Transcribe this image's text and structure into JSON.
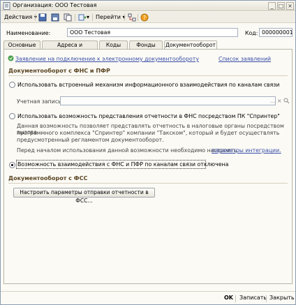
{
  "window": {
    "title": "Организация: ООО Тестовая"
  },
  "toolbar": {
    "actions_label": "Действия",
    "goto_label": "Перейти"
  },
  "form": {
    "name_label": "Наименование:",
    "name_value": "ООО Тестовая",
    "code_label": "Код:",
    "code_value": "000000001"
  },
  "tabs": [
    {
      "label": "Основные"
    },
    {
      "label": "Адреса и телефоны"
    },
    {
      "label": "Коды"
    },
    {
      "label": "Фонды"
    },
    {
      "label": "Документооборот"
    }
  ],
  "doc": {
    "statement_link": "Заявление на подключение к электронному документообороту",
    "statements_list_link": "Список заявлений",
    "fns_header": "Документооборот с ФНС и ПФР",
    "option1": "Использовать встроенный механизм информационного взаимодействия по каналам связи",
    "account_label": "Учетная запись:",
    "option2": "Использовать возможность представления отчетности в ФНС посредством ПК \"Спринтер\"",
    "option2_desc1": "Данная возможность позволяет представлять отчетность в налоговые органы посредством вызова",
    "option2_desc2": "программного комплекса \"Спринтер\" компании \"Такском\", который и будет осуществлять",
    "option2_desc3": "предусмотренный регламентом документооборот.",
    "integration_text": "Перед началом использования данной возможности необходимо настроить",
    "integration_link": "параметры интеграции.",
    "option3": "Возможность взаимодействия с ФНС и ПФР по каналам связи отключена",
    "fss_header": "Документооборот с ФСС",
    "fss_button": "Настроить параметры отправки отчетности в ФСС..."
  },
  "footer": {
    "ok_label": "OK",
    "save_label": "Записать",
    "close_label": "Закрыть"
  },
  "colors": {
    "header_text": "#5a4522",
    "link": "#3a4fa8",
    "border": "#8a9bb4"
  }
}
